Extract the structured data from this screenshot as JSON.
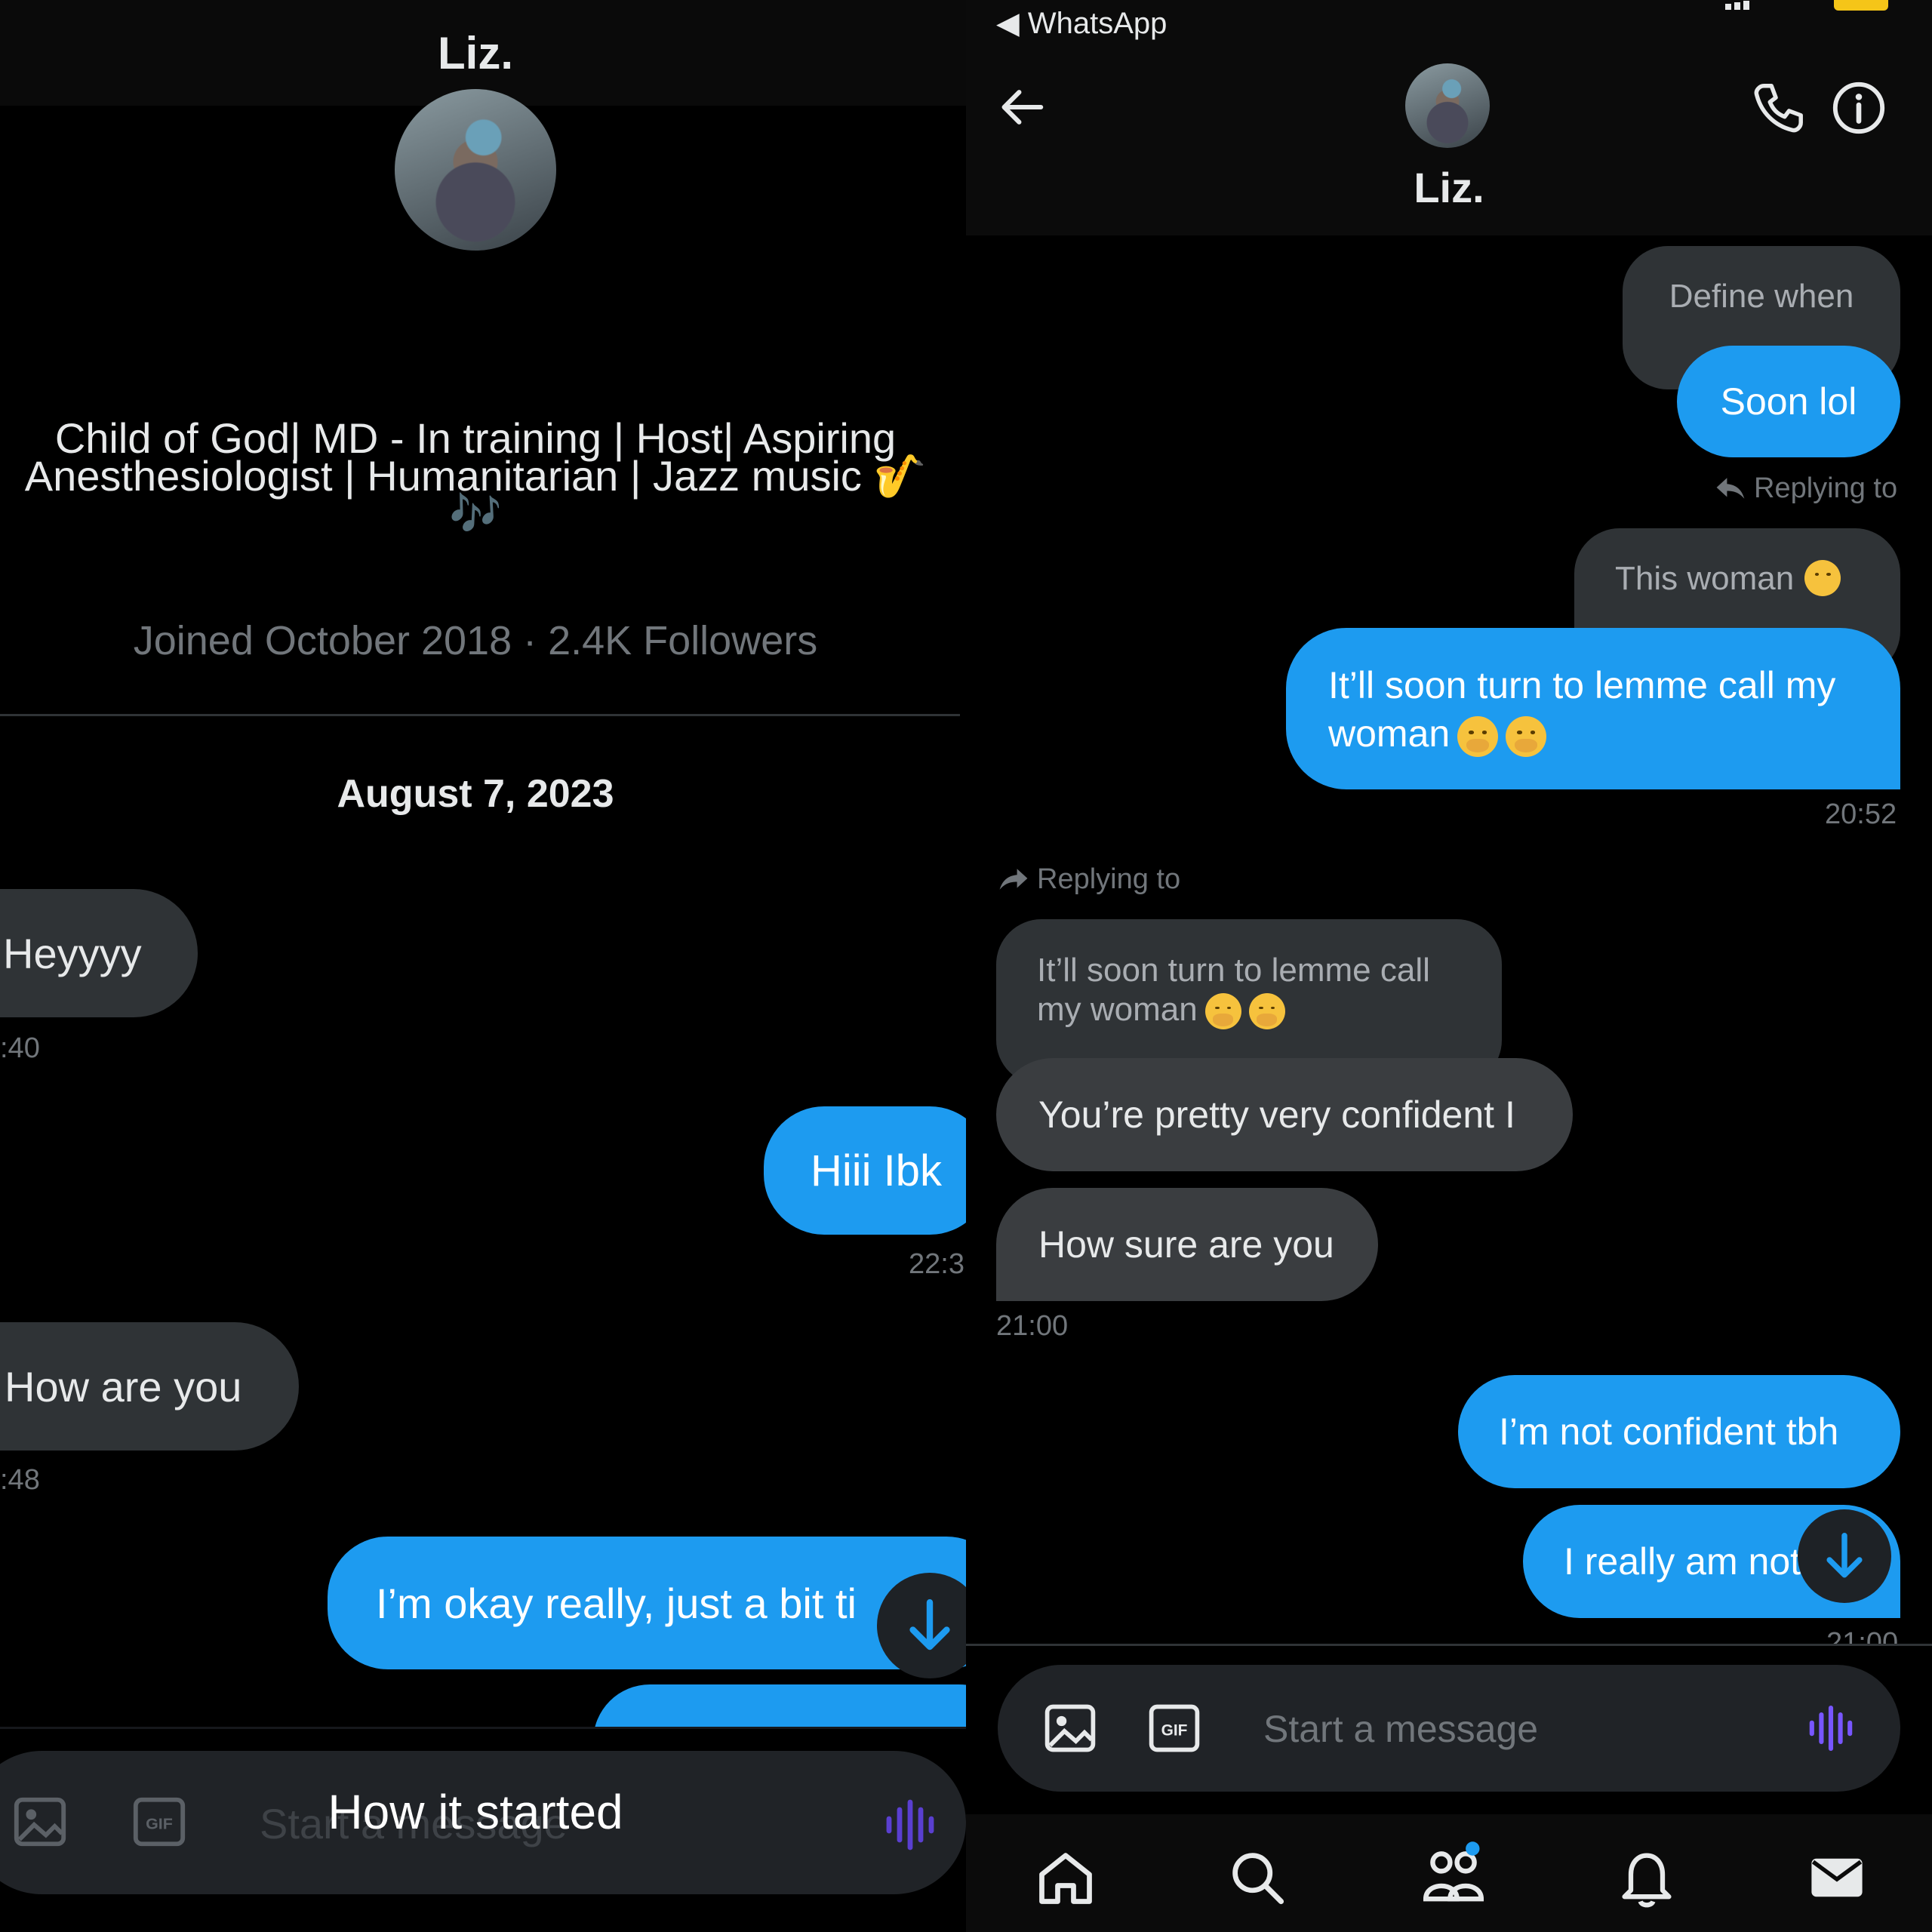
{
  "left": {
    "header_name": "Liz.",
    "bio": "Child of God| MD - In training | Host| Aspiring Anesthesiologist | Humanitarian | Jazz music 🎷🎶",
    "bio_line1": "Child of God| MD - In training | Host| Aspiring",
    "bio_line2": "Anesthesiologist | Humanitarian | Jazz music",
    "meta": "Joined October 2018 · 2.4K Followers",
    "date": "August 7, 2023",
    "messages": [
      {
        "side": "received",
        "text": "Heyyyy",
        "time": ":40"
      },
      {
        "side": "sent",
        "text": "Hiii Ibk",
        "time": "22:3"
      },
      {
        "side": "received",
        "text": "How are you",
        "time": ":48"
      },
      {
        "side": "sent",
        "text": "I’m okay really, just a bit ti"
      }
    ],
    "composer_placeholder": "Start a message",
    "caption": "How it started"
  },
  "right": {
    "status_back": "◀ WhatsApp",
    "header_name": "Liz.",
    "messages": [
      {
        "side": "received",
        "text": "Define when"
      },
      {
        "side": "sent",
        "text": "Soon lol"
      },
      {
        "replying_label": "Replying to"
      },
      {
        "side": "quoted",
        "text": "This woman"
      },
      {
        "side": "sent",
        "text_line1": "It’ll soon turn to lemme call my",
        "text_line2": "woman",
        "time": "20:52"
      },
      {
        "replying_label": "Replying to"
      },
      {
        "side": "quoted",
        "text_line1": "It’ll soon turn to lemme call",
        "text_line2": "my woman"
      },
      {
        "side": "received",
        "text": "You’re pretty very confident I"
      },
      {
        "side": "received",
        "text": "How sure are you",
        "time": "21:00"
      },
      {
        "side": "sent",
        "text": "I’m not confident tbh"
      },
      {
        "side": "sent",
        "text": "I really am not",
        "time": "21:00"
      }
    ],
    "composer_placeholder": "Start a message"
  },
  "colors": {
    "accent": "#1d9bf0",
    "bubble_received": "#2f3336",
    "muted": "#71767b",
    "voice": "#7856ff"
  },
  "icons": [
    "back-arrow-icon",
    "phone-icon",
    "info-icon",
    "image-icon",
    "gif-icon",
    "voice-icon",
    "scroll-down-icon",
    "home-icon",
    "search-icon",
    "communities-icon",
    "notifications-icon",
    "messages-icon",
    "reply-icon"
  ]
}
